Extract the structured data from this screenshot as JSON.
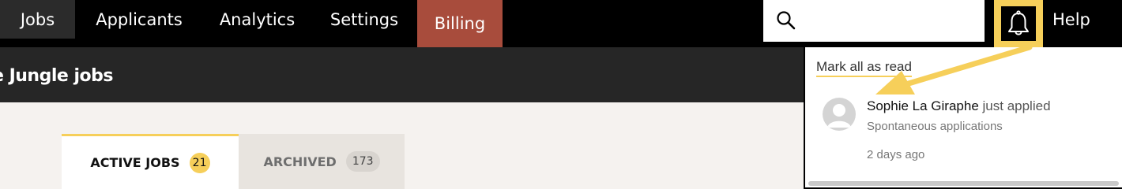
{
  "nav": {
    "items": [
      {
        "label": "Jobs"
      },
      {
        "label": "Applicants"
      },
      {
        "label": "Analytics"
      },
      {
        "label": "Settings"
      },
      {
        "label": "Billing"
      }
    ],
    "help_label": "Help",
    "search": {
      "value": ""
    }
  },
  "header": {
    "title": "e Jungle jobs"
  },
  "tabs": [
    {
      "label": "ACTIVE JOBS",
      "count": "21",
      "active": true
    },
    {
      "label": "ARCHIVED",
      "count": "173",
      "active": false
    }
  ],
  "notifications": {
    "mark_all_label": "Mark all as read",
    "items": [
      {
        "name": "Sophie La Giraphe",
        "action": "just applied",
        "subtitle": "Spontaneous applications",
        "time": "2 days ago"
      }
    ]
  },
  "colors": {
    "accent": "#f6cf5a",
    "billing": "#a84c3c",
    "nav_bg": "#000000",
    "subheader_bg": "#262626"
  },
  "icons": [
    "search-icon",
    "bell-icon",
    "avatar-icon"
  ]
}
